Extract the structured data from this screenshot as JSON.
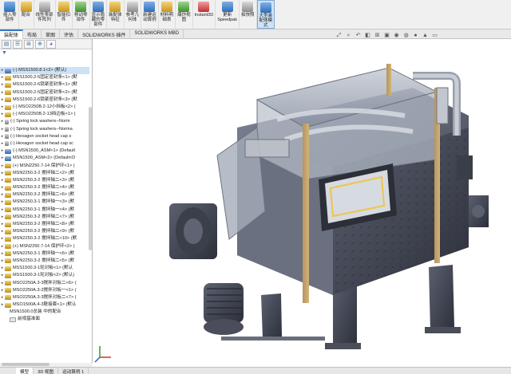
{
  "ribbon": {
    "buttons": [
      {
        "label": "插入零\n部件",
        "icon": "insert-part-icon"
      },
      {
        "label": "配合",
        "icon": "mate-icon"
      },
      {
        "label": "线性零部\n件阵列",
        "icon": "linear-pattern-icon"
      },
      {
        "label": "智能扣\n件",
        "icon": "smart-fastener-icon"
      },
      {
        "label": "移动零\n部件",
        "icon": "move-component-icon"
      },
      {
        "label": "显示隐\n藏的零\n部件",
        "icon": "show-hidden-icon"
      },
      {
        "label": "装配体\n特征",
        "icon": "assembly-feature-icon"
      },
      {
        "label": "参考几\n何体",
        "icon": "reference-geometry-icon"
      },
      {
        "label": "新建运\n动算例",
        "icon": "motion-study-icon"
      },
      {
        "label": "材料明\n细表",
        "icon": "bom-icon"
      },
      {
        "label": "爆炸视\n图",
        "icon": "exploded-view-icon"
      },
      {
        "label": "Instant3D",
        "icon": "instant3d-icon"
      },
      {
        "label": "更新\nSpeedpak",
        "icon": "speedpak-icon"
      },
      {
        "label": "拍快照",
        "icon": "snapshot-icon"
      },
      {
        "label": "大型装\n配体模\n式",
        "icon": "large-assembly-icon"
      }
    ]
  },
  "command_tabs": [
    "装配体",
    "布局",
    "草图",
    "评估",
    "SOLIDWORKS 插件",
    "SOLIDWORKS MBD"
  ],
  "tree": {
    "rows": [
      {
        "label": "(-) MSS1500.8.1<2> (默认)",
        "type": "asm",
        "selected": true
      },
      {
        "label": "MSS1500.2-5固定密封条<1> (默",
        "type": "part"
      },
      {
        "label": "MSS1500.2-6锁紧密封条<1> (默",
        "type": "part"
      },
      {
        "label": "MSS1500.2-5固定密封条<2> (默",
        "type": "part"
      },
      {
        "label": "MSS1500.2-6锁紧密封条<3> (默",
        "type": "part"
      },
      {
        "label": "(-) MSO2250B.2-12小挡板<2> (",
        "type": "part"
      },
      {
        "label": "(-) MSO2250B.2-13挡边板<1> (",
        "type": "part"
      },
      {
        "label": "(-) Spring lock washers--Norm",
        "type": "hw"
      },
      {
        "label": "(-) Spring lock washers--Norma",
        "type": "hw"
      },
      {
        "label": "(-) Hexagon socket head cap s",
        "type": "hw"
      },
      {
        "label": "(-) Hexagon socket head cap sc",
        "type": "hw"
      },
      {
        "label": "(-) MSN1500_ASM<1> (Default",
        "type": "asm"
      },
      {
        "label": "MSN1500_ASM<2> (Default<D",
        "type": "asm"
      },
      {
        "label": "(+) MSN2250.7-14 保护环<1> (",
        "type": "part"
      },
      {
        "label": "MSN2250.3-2 搅拌轴二<2> (默",
        "type": "part"
      },
      {
        "label": "MSN2250.3-2 搅拌轴二<3> (默",
        "type": "part"
      },
      {
        "label": "MSN2250.3-2 搅拌轴二<4> (默",
        "type": "part"
      },
      {
        "label": "MSN2250.3-2 搅拌轴二<6> (默",
        "type": "part"
      },
      {
        "label": "MSN2250.3-1 搅拌轴一<3> (默",
        "type": "part"
      },
      {
        "label": "MSN2250.3-1 搅拌轴一<4> (默",
        "type": "part"
      },
      {
        "label": "MSN2250.3-2 搅拌轴二<7> (默",
        "type": "part"
      },
      {
        "label": "MSN2250.3-2 搅拌轴二<8> (默",
        "type": "part"
      },
      {
        "label": "MSN2250.3-2 搅拌轴二<9> (默",
        "type": "part"
      },
      {
        "label": "MSN2250.3-2 搅拌轴二<10> (默",
        "type": "part"
      },
      {
        "label": "(+) MSN2250.7-14 保护环<2> (",
        "type": "part"
      },
      {
        "label": "MSN2250.3-1 搅拌轴一<6> (默",
        "type": "part"
      },
      {
        "label": "MSN2250.3-2 搅拌轴二<5> (默",
        "type": "part"
      },
      {
        "label": "MSS1500.3-1轮对板<1> (默认",
        "type": "part"
      },
      {
        "label": "MSS1500.3-1轮对板<2> (默认)",
        "type": "part"
      },
      {
        "label": "MSO2250A.3-3搅拌对板二<6> (",
        "type": "part"
      },
      {
        "label": "MSO2250A.3-2搅拌对板一<1> (",
        "type": "part"
      },
      {
        "label": "MSO2250A.3-3搅拌对板二<7> (",
        "type": "part"
      },
      {
        "label": "MSO1500A.4-3联接套<1> (默认",
        "type": "part"
      },
      {
        "label": "MSN1500.0总装 中的配合",
        "type": "view",
        "child": true
      },
      {
        "label": "前视基准面",
        "type": "plane",
        "child": true
      }
    ]
  },
  "bottom_tabs": [
    "模型",
    "3D 视图",
    "运动算例 1"
  ],
  "colors": {
    "accent": "#3a76c4",
    "selection": "#cde1f7",
    "machine": "#5a5f70"
  }
}
